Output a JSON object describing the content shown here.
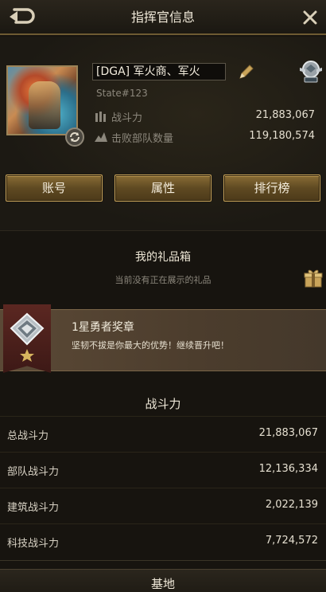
{
  "header": {
    "title": "指挥官信息",
    "back_icon": "back-arrow-icon",
    "close_icon": "close-icon"
  },
  "profile": {
    "name": "[DGA] 军火商、军火",
    "state": "State#123",
    "power_label": "战斗力",
    "power_value": "21,883,067",
    "kills_label": "击败部队数量",
    "kills_value": "119,180,574"
  },
  "buttons": {
    "account": "账号",
    "attributes": "属性",
    "leaderboard": "排行榜"
  },
  "gift": {
    "title": "我的礼品箱",
    "subtitle": "当前没有正在展示的礼品"
  },
  "medal": {
    "title": "1星勇者奖章",
    "desc": "坚韧不拔是你最大的优势！继续晋升吧！"
  },
  "power_section": {
    "title": "战斗力",
    "rows": [
      {
        "label": "总战斗力",
        "value": "21,883,067"
      },
      {
        "label": "部队战斗力",
        "value": "12,136,334"
      },
      {
        "label": "建筑战斗力",
        "value": "2,022,139"
      },
      {
        "label": "科技战斗力",
        "value": "7,724,572"
      }
    ]
  },
  "base_section": {
    "title": "基地"
  },
  "colors": {
    "gold_accent": "#c9a45a",
    "background": "#17140f"
  }
}
